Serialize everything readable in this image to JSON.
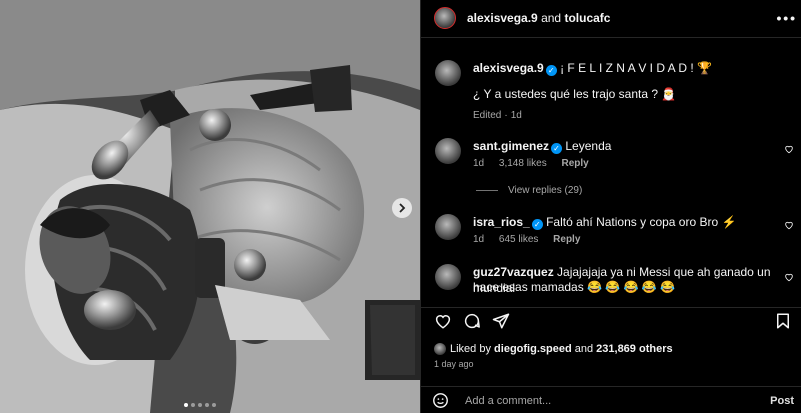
{
  "header": {
    "user1": "alexisvega.9",
    "and_text": "and",
    "user2": "tolucafc",
    "more_icon": "more-horizontal-icon"
  },
  "caption": {
    "username": "alexisvega.9",
    "text": "¡ F E L I Z N A V I D A D !",
    "trophy_emoji": "🏆",
    "line2": "¿ Y a ustedes qué les trajo santa ?",
    "santa_emoji": "🎅",
    "edited": "Edited",
    "sep": "·",
    "time": "1d"
  },
  "comments": [
    {
      "username": "sant.gimenez",
      "verified": true,
      "text": "Leyenda",
      "time": "1d",
      "likes": "3,148 likes",
      "reply": "Reply"
    },
    {
      "username": "isra_rios_",
      "verified": true,
      "text": "Faltó ahí Nations y copa oro Bro",
      "emoji": "⚡",
      "time": "1d",
      "likes": "645 likes",
      "reply": "Reply"
    },
    {
      "username": "guz27vazquez",
      "verified": false,
      "text": "Jajajajaja ya ni Messi que ah ganado un mundial",
      "text2": "hace esas mamadas",
      "emoji": "😂 😂 😂 😂 😂"
    }
  ],
  "view_replies": "View replies (29)",
  "liked_by": {
    "prefix": "Liked by",
    "user": "diegofig.speed",
    "and": "and",
    "count": "231,869 others"
  },
  "posted_ago": "1 day ago",
  "add_comment": {
    "placeholder": "Add a comment...",
    "post": "Post"
  },
  "carousel": {
    "dots": 5,
    "active": 0
  }
}
